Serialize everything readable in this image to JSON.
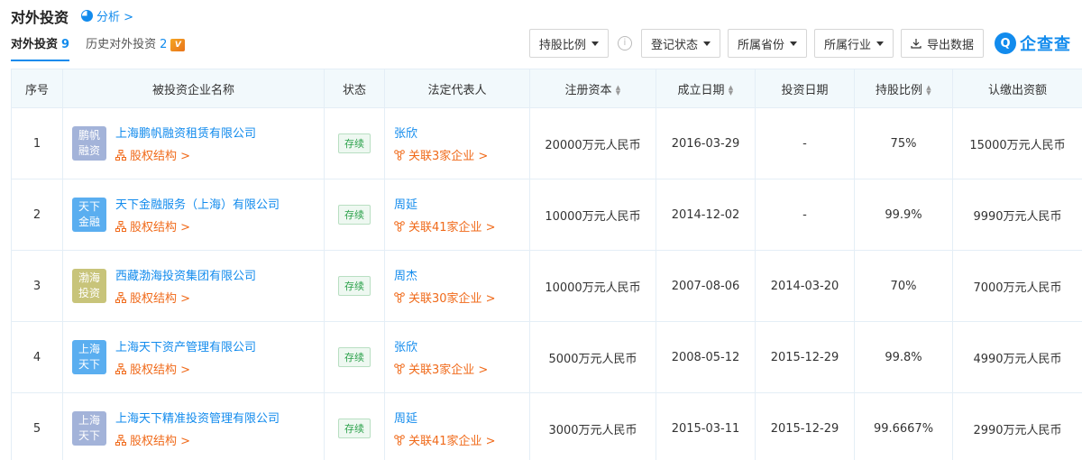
{
  "header": {
    "title": "对外投资",
    "analysis": "分析 >"
  },
  "tabs": [
    {
      "label": "对外投资",
      "count": "9"
    },
    {
      "label": "历史对外投资",
      "count": "2"
    }
  ],
  "toolbar": {
    "ratio": "持股比例",
    "reg_status": "登记状态",
    "province": "所属省份",
    "industry": "所属行业",
    "export": "导出数据",
    "brand": "企查查"
  },
  "table": {
    "headers": [
      "序号",
      "被投资企业名称",
      "状态",
      "法定代表人",
      "注册资本",
      "成立日期",
      "投资日期",
      "持股比例",
      "认缴出资额"
    ],
    "rows": [
      {
        "idx": "1",
        "logo": "鹏帆\n融资",
        "logo_color": "#a3b3d9",
        "name": "上海鹏帆融资租赁有限公司",
        "equity": "股权结构 >",
        "status": "存续",
        "rep": "张欣",
        "rep_link": "关联3家企业 >",
        "capital": "20000万元人民币",
        "founded": "2016-03-29",
        "invested": "-",
        "ratio": "75%",
        "subscribed": "15000万元人民币"
      },
      {
        "idx": "2",
        "logo": "天下\n金融",
        "logo_color": "#5aaef0",
        "name": "天下金融服务（上海）有限公司",
        "equity": "股权结构 >",
        "status": "存续",
        "rep": "周延",
        "rep_link": "关联41家企业 >",
        "capital": "10000万元人民币",
        "founded": "2014-12-02",
        "invested": "-",
        "ratio": "99.9%",
        "subscribed": "9990万元人民币"
      },
      {
        "idx": "3",
        "logo": "渤海\n投资",
        "logo_color": "#c8c47a",
        "name": "西藏渤海投资集团有限公司",
        "equity": "股权结构 >",
        "status": "存续",
        "rep": "周杰",
        "rep_link": "关联30家企业 >",
        "capital": "10000万元人民币",
        "founded": "2007-08-06",
        "invested": "2014-03-20",
        "ratio": "70%",
        "subscribed": "7000万元人民币"
      },
      {
        "idx": "4",
        "logo": "上海\n天下",
        "logo_color": "#5aaef0",
        "name": "上海天下资产管理有限公司",
        "equity": "股权结构 >",
        "status": "存续",
        "rep": "张欣",
        "rep_link": "关联3家企业 >",
        "capital": "5000万元人民币",
        "founded": "2008-05-12",
        "invested": "2015-12-29",
        "ratio": "99.8%",
        "subscribed": "4990万元人民币"
      },
      {
        "idx": "5",
        "logo": "上海\n天下",
        "logo_color": "#a3b3d9",
        "name": "上海天下精准投资管理有限公司",
        "equity": "股权结构 >",
        "status": "存续",
        "rep": "周延",
        "rep_link": "关联41家企业 >",
        "capital": "3000万元人民币",
        "founded": "2015-03-11",
        "invested": "2015-12-29",
        "ratio": "99.6667%",
        "subscribed": "2990万元人民币"
      }
    ]
  }
}
